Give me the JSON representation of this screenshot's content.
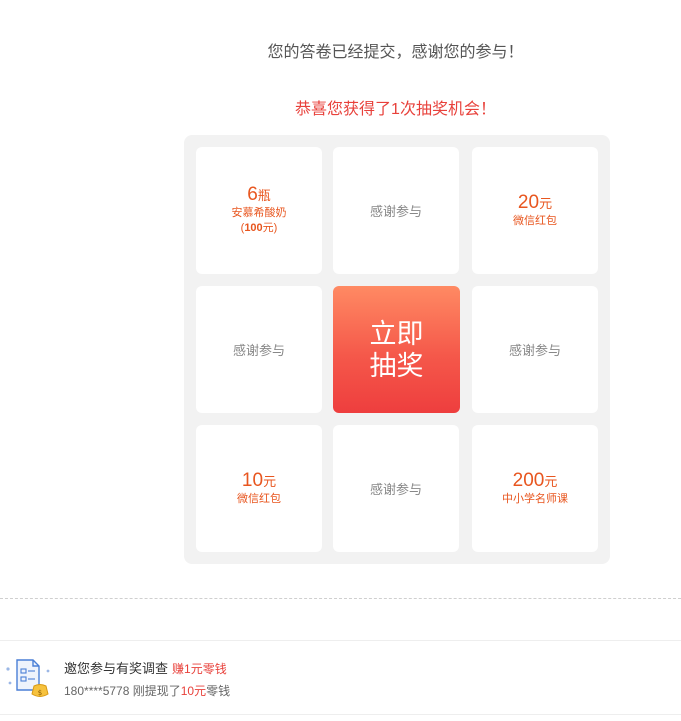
{
  "header": {
    "submitted_message": "您的答卷已经提交，感谢您的参与！",
    "congrats_message": "恭喜您获得了1次抽奖机会！"
  },
  "lottery": {
    "cells": [
      {
        "amount": "6",
        "unit": "瓶",
        "line1": "安慕希酸奶",
        "line2_prefix": "(",
        "line2_bold": "100",
        "line2_suffix": "元)"
      },
      {
        "text": "感谢参与"
      },
      {
        "amount": "20",
        "unit": "元",
        "line1": "微信红包"
      },
      {
        "text": "感谢参与"
      },
      {
        "text": "感谢参与"
      },
      {
        "amount": "10",
        "unit": "元",
        "line1": "微信红包"
      },
      {
        "text": "感谢参与"
      },
      {
        "amount": "200",
        "unit": "元",
        "line1": "中小学名师课"
      }
    ],
    "draw_button": "立即抽奖"
  },
  "promo": {
    "title": "邀您参与有奖调查",
    "earn_text": "赚1元零钱",
    "user": "180****5778",
    "action_prefix": " 刚提现了",
    "amount": "10元",
    "action_suffix": "零钱"
  },
  "colors": {
    "accent_red": "#e8413b",
    "prize_orange": "#e8561f",
    "button_gradient_top": "#ff8a63",
    "button_gradient_bottom": "#ee3e3e"
  }
}
